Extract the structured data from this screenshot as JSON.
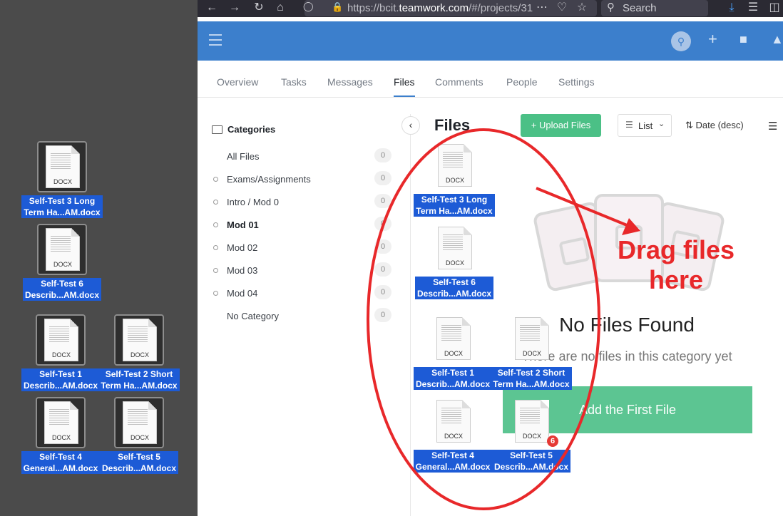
{
  "browser": {
    "url_prefix": "https://bcit.",
    "url_domain": "teamwork.com",
    "url_rest": "/#/projects/31",
    "search_placeholder": "Search"
  },
  "tabs": [
    "Overview",
    "Tasks",
    "Messages",
    "Files",
    "Comments",
    "People",
    "Settings"
  ],
  "active_tab": "Files",
  "sidebar": {
    "heading": "Categories",
    "items": [
      {
        "label": "All Files",
        "count": "0"
      },
      {
        "label": "Exams/Assignments",
        "count": "0"
      },
      {
        "label": "Intro / Mod 0",
        "count": "0"
      },
      {
        "label": "Mod 01",
        "count": "0"
      },
      {
        "label": "Mod 02",
        "count": "0"
      },
      {
        "label": "Mod 03",
        "count": "0"
      },
      {
        "label": "Mod 04",
        "count": "0"
      },
      {
        "label": "No Category",
        "count": "0"
      }
    ]
  },
  "main": {
    "title": "Files",
    "upload_label": "+ Upload Files",
    "view_label": "List",
    "sort_label": "Date (desc)",
    "empty_title": "No Files Found",
    "empty_sub": "There are no files in this category yet",
    "add_first_label": "Add the First File"
  },
  "annotation": {
    "line1": "Drag files",
    "line2": "here"
  },
  "desktop_files": [
    {
      "line1": "Self-Test 3 Long",
      "line2": "Term Ha...AM.docx",
      "ext": "DOCX"
    },
    {
      "line1": "Self-Test 6",
      "line2": "Describ...AM.docx",
      "ext": "DOCX"
    },
    {
      "line1": "Self-Test 1",
      "line2": "Describ...AM.docx",
      "ext": "DOCX"
    },
    {
      "line1": "Self-Test 2 Short",
      "line2": "Term Ha...AM.docx",
      "ext": "DOCX"
    },
    {
      "line1": "Self-Test 4",
      "line2": "General...AM.docx",
      "ext": "DOCX"
    },
    {
      "line1": "Self-Test 5",
      "line2": "Describ...AM.docx",
      "ext": "DOCX"
    }
  ],
  "drag_badge": "6",
  "colors": {
    "accent": "#3c7fcc",
    "green": "#4bc086",
    "annotation": "#e8282a"
  }
}
